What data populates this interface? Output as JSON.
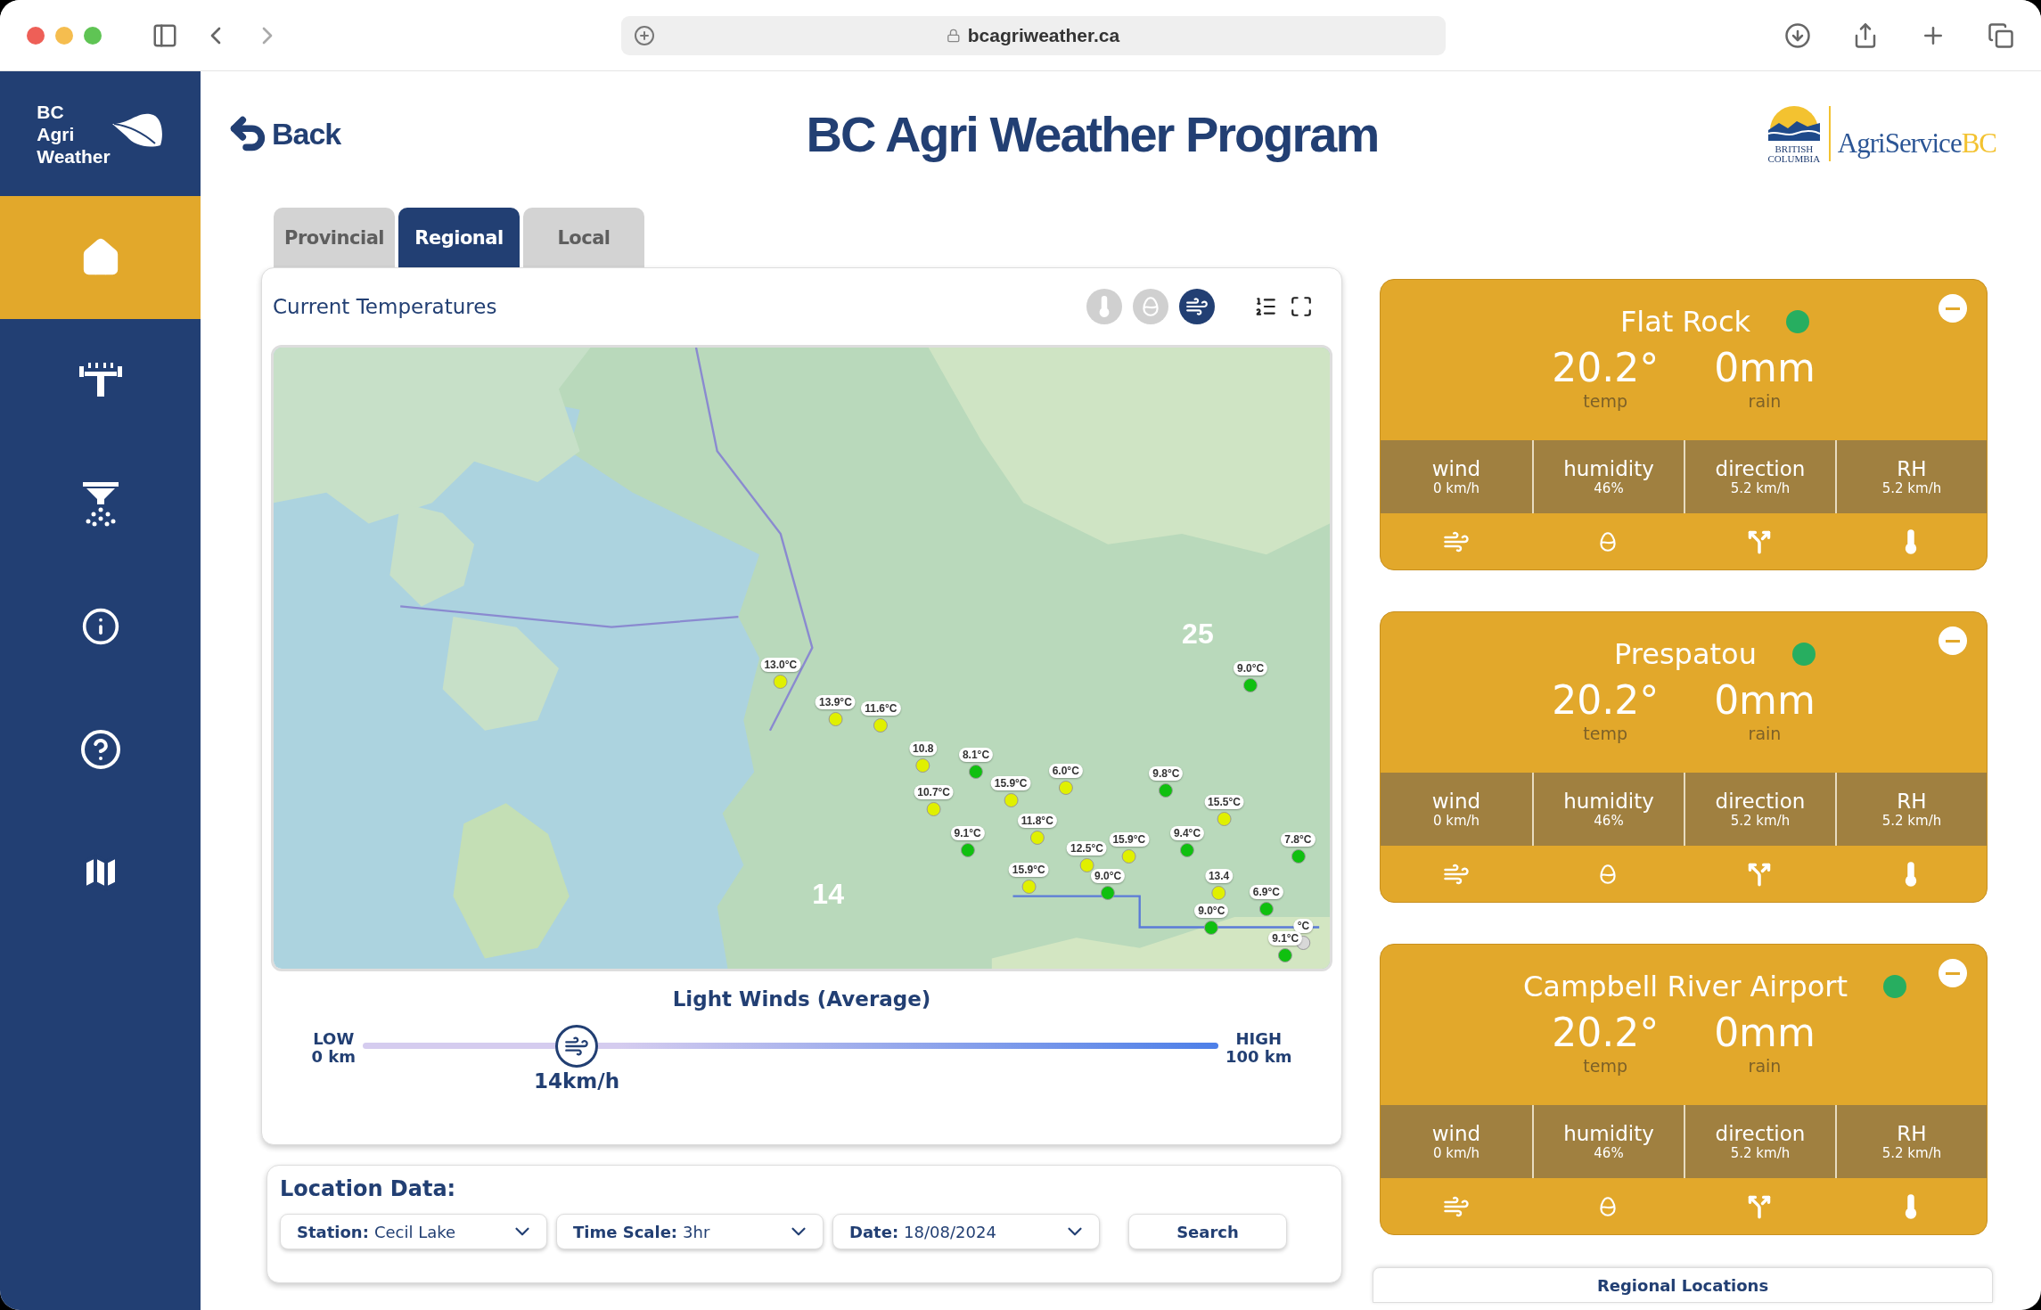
{
  "browser": {
    "url": "bcagriweather.ca"
  },
  "sidebar": {
    "logo": [
      "BC",
      "Agri",
      "Weather"
    ],
    "items": [
      {
        "kind": "home",
        "selected": true
      },
      {
        "kind": "sprinkler",
        "selected": false
      },
      {
        "kind": "spray",
        "selected": false
      },
      {
        "kind": "info",
        "selected": false
      },
      {
        "kind": "help",
        "selected": false
      },
      {
        "kind": "map",
        "selected": false
      }
    ]
  },
  "header": {
    "back": "Back",
    "title": "BC Agri Weather Program",
    "partner": {
      "province": [
        "BRITISH",
        "COLUMBIA"
      ],
      "name": "AgriService",
      "suffix": "BC"
    }
  },
  "tabs": [
    {
      "label": "Provincial",
      "selected": false
    },
    {
      "label": "Regional",
      "selected": true
    },
    {
      "label": "Local",
      "selected": false
    }
  ],
  "map_panel": {
    "title": "Current Temperatures",
    "layers": [
      {
        "kind": "temperature",
        "selected": false
      },
      {
        "kind": "humidity",
        "selected": false
      },
      {
        "kind": "wind",
        "selected": true
      }
    ],
    "clusters": [
      "25",
      "14"
    ],
    "markers": [
      {
        "label": "13.0°C",
        "color": "#e0f000"
      },
      {
        "label": "13.9°C",
        "color": "#e0f000"
      },
      {
        "label": "11.6°C",
        "color": "#e0f000"
      },
      {
        "label": "10.8",
        "color": "#e0f000"
      },
      {
        "label": "8.1°C",
        "color": "#10c010"
      },
      {
        "label": "10.7°C",
        "color": "#e0f000"
      },
      {
        "label": "9.1°C",
        "color": "#10c010"
      },
      {
        "label": "15.9°C",
        "color": "#e0f000"
      },
      {
        "label": "6.0°C",
        "color": "#e0f000"
      },
      {
        "label": "11.8°C",
        "color": "#e0f000"
      },
      {
        "label": "12.5°C",
        "color": "#e0f000"
      },
      {
        "label": "15.9°C",
        "color": "#e0f000"
      },
      {
        "label": "9.0°C",
        "color": "#10c010"
      },
      {
        "label": "15.9°C",
        "color": "#e0f000"
      },
      {
        "label": "9.8°C",
        "color": "#10c010"
      },
      {
        "label": "9.4°C",
        "color": "#10c010"
      },
      {
        "label": "15.5°C",
        "color": "#e0f000"
      },
      {
        "label": "13.4",
        "color": "#e0f000"
      },
      {
        "label": "6.9°C",
        "color": "#10c010"
      },
      {
        "label": "7.8°C",
        "color": "#10c010"
      },
      {
        "label": "°C",
        "color": "#d8d8d8"
      },
      {
        "label": "9.0°C",
        "color": "#10c010"
      },
      {
        "label": "9.1°C",
        "color": "#10c010"
      },
      {
        "label": "9.0°C",
        "color": "#10c010"
      }
    ],
    "legend": {
      "title": "Light Winds (Average)",
      "low_label": "LOW",
      "low_value": "0 km",
      "high_label": "HIGH",
      "high_value": "100 km",
      "reading": "14km/h",
      "level": 0.25
    }
  },
  "location_data": {
    "title": "Location Data:",
    "fields": [
      {
        "label": "Station:",
        "value": "Cecil Lake"
      },
      {
        "label": "Time Scale:",
        "value": "3hr"
      },
      {
        "label": "Date:",
        "value": "18/08/2024"
      }
    ],
    "button": "Search"
  },
  "stations": [
    {
      "name": "Flat Rock",
      "online": true,
      "temp": "20.2°",
      "temp_label": "temp",
      "rain": "0mm",
      "rain_label": "rain",
      "stats": [
        {
          "kind": "wind",
          "label": "wind",
          "value": "0 km/h"
        },
        {
          "kind": "humidity",
          "label": "humidity",
          "value": "46%"
        },
        {
          "kind": "direction",
          "label": "direction",
          "value": "5.2 km/h"
        },
        {
          "kind": "rh",
          "label": "RH",
          "value": "5.2 km/h"
        }
      ]
    },
    {
      "name": "Prespatou",
      "online": true,
      "temp": "20.2°",
      "temp_label": "temp",
      "rain": "0mm",
      "rain_label": "rain",
      "stats": [
        {
          "kind": "wind",
          "label": "wind",
          "value": "0 km/h"
        },
        {
          "kind": "humidity",
          "label": "humidity",
          "value": "46%"
        },
        {
          "kind": "direction",
          "label": "direction",
          "value": "5.2 km/h"
        },
        {
          "kind": "rh",
          "label": "RH",
          "value": "5.2 km/h"
        }
      ]
    },
    {
      "name": "Campbell River Airport",
      "online": true,
      "temp": "20.2°",
      "temp_label": "temp",
      "rain": "0mm",
      "rain_label": "rain",
      "stats": [
        {
          "kind": "wind",
          "label": "wind",
          "value": "0 km/h"
        },
        {
          "kind": "humidity",
          "label": "humidity",
          "value": "46%"
        },
        {
          "kind": "direction",
          "label": "direction",
          "value": "5.2 km/h"
        },
        {
          "kind": "rh",
          "label": "RH",
          "value": "5.2 km/h"
        }
      ]
    }
  ],
  "regional_locations": "Regional Locations"
}
